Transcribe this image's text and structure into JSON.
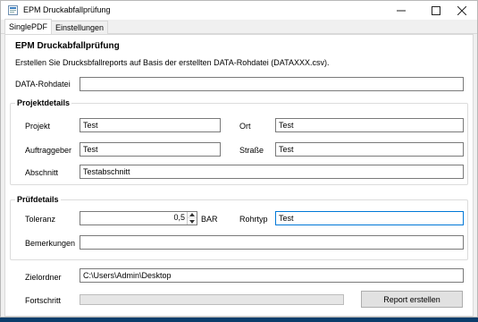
{
  "window": {
    "title": "EPM Druckabfallprüfung",
    "controls": [
      "—",
      "☐",
      "✕"
    ]
  },
  "tabs": [
    {
      "label": "SinglePDF",
      "active": true
    },
    {
      "label": "Einstellungen",
      "active": false
    }
  ],
  "header": {
    "title": "EPM Druckabfallprüfung",
    "subtitle": "Erstellen Sie Drucksbfallreports auf Basis der erstellten DATA-Rohdatei (DATAXXX.csv)."
  },
  "data_file": {
    "label": "DATA-Rohdatei",
    "value": ""
  },
  "project": {
    "title": "Projektdetails",
    "projekt": {
      "label": "Projekt",
      "value": "Test"
    },
    "ort": {
      "label": "Ort",
      "value": "Test"
    },
    "auftraggeber": {
      "label": "Auftraggeber",
      "value": "Test"
    },
    "strasse": {
      "label": "Straße",
      "value": "Test"
    },
    "abschnitt": {
      "label": "Abschnitt",
      "value": "Testabschnitt"
    }
  },
  "pruef": {
    "title": "Prüfdetails",
    "toleranz": {
      "label": "Toleranz",
      "value": "0,5",
      "unit": "BAR"
    },
    "rohrtyp": {
      "label": "Rohrtyp",
      "value": "Test"
    },
    "bemerkungen": {
      "label": "Bemerkungen",
      "value": ""
    }
  },
  "output": {
    "zielordner": {
      "label": "Zielordner",
      "value": "C:\\Users\\Admin\\Desktop"
    },
    "fortschritt": {
      "label": "Fortschritt",
      "progress": 0
    },
    "button": "Report erstellen"
  },
  "colors": {
    "accent": "#0078d7",
    "progress": "#06b025",
    "desktop": "#0a3d6b"
  }
}
